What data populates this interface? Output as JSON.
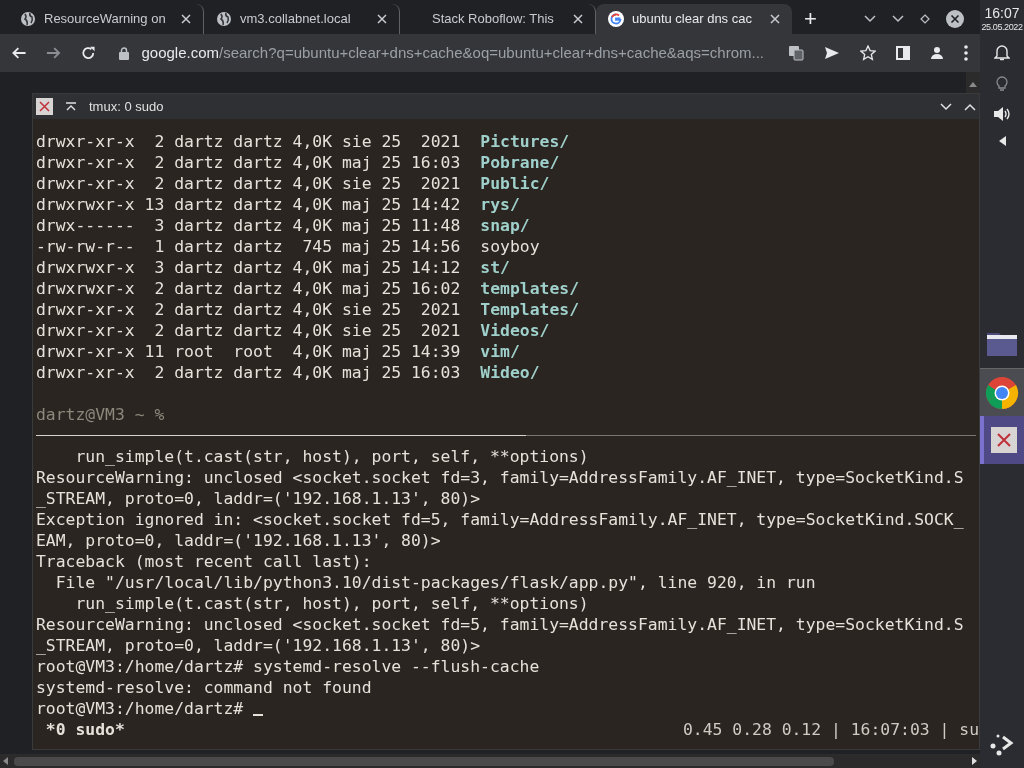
{
  "browser": {
    "tabs": [
      {
        "title": "ResourceWarning on",
        "kind": "globe",
        "selected": false
      },
      {
        "title": "vm3.collabnet.local",
        "kind": "globe",
        "selected": false
      },
      {
        "title": "Stack Roboflow: This",
        "kind": "plain",
        "selected": false
      },
      {
        "title": "ubuntu clear dns cac",
        "kind": "google",
        "selected": true
      }
    ],
    "new_tab": "+",
    "address": {
      "host": "google.com",
      "path": "/search?q=ubuntu+clear+dns+cache&oq=ubuntu+clear+dns+cache&aqs=chrom..."
    }
  },
  "terminal": {
    "title": "tmux: 0 sudo",
    "listing": [
      {
        "info": "drwxr-xr-x  2 dartz dartz 4,0K sie 25  2021",
        "name": "Pictures/",
        "kind": "directory"
      },
      {
        "info": "drwxr-xr-x  2 dartz dartz 4,0K maj 25 16:03",
        "name": "Pobrane/",
        "kind": "directory"
      },
      {
        "info": "drwxr-xr-x  2 dartz dartz 4,0K sie 25  2021",
        "name": "Public/",
        "kind": "directory"
      },
      {
        "info": "drwxrwxr-x 13 dartz dartz 4,0K maj 25 14:42",
        "name": "rys/",
        "kind": "directory"
      },
      {
        "info": "drwx------  3 dartz dartz 4,0K maj 25 11:48",
        "name": "snap/",
        "kind": "directory"
      },
      {
        "info": "-rw-rw-r--  1 dartz dartz  745 maj 25 14:56",
        "name": "soyboy",
        "kind": "file"
      },
      {
        "info": "drwxrwxr-x  3 dartz dartz 4,0K maj 25 14:12",
        "name": "st/",
        "kind": "directory"
      },
      {
        "info": "drwxrwxr-x  2 dartz dartz 4,0K maj 25 16:02",
        "name": "templates/",
        "kind": "directory"
      },
      {
        "info": "drwxr-xr-x  2 dartz dartz 4,0K sie 25  2021",
        "name": "Templates/",
        "kind": "directory"
      },
      {
        "info": "drwxr-xr-x  2 dartz dartz 4,0K sie 25  2021",
        "name": "Videos/",
        "kind": "directory"
      },
      {
        "info": "drwxr-xr-x 11 root  root  4,0K maj 25 14:39",
        "name": "vim/",
        "kind": "directory"
      },
      {
        "info": "drwxr-xr-x  2 dartz dartz 4,0K maj 25 16:03",
        "name": "Wideo/",
        "kind": "directory"
      }
    ],
    "prompt": "dartz@VM3 ~ %",
    "output": [
      "    run_simple(t.cast(str, host), port, self, **options)",
      "ResourceWarning: unclosed <socket.socket fd=3, family=AddressFamily.AF_INET, type=SocketKind.S",
      "_STREAM, proto=0, laddr=('192.168.1.13', 80)>",
      "Exception ignored in: <socket.socket fd=5, family=AddressFamily.AF_INET, type=SocketKind.SOCK_",
      "EAM, proto=0, laddr=('192.168.1.13', 80)>",
      "Traceback (most recent call last):",
      "  File \"/usr/local/lib/python3.10/dist-packages/flask/app.py\", line 920, in run",
      "    run_simple(t.cast(str, host), port, self, **options)",
      "ResourceWarning: unclosed <socket.socket fd=5, family=AddressFamily.AF_INET, type=SocketKind.S",
      "_STREAM, proto=0, laddr=('192.168.1.13', 80)>",
      "root@VM3:/home/dartz# systemd-resolve --flush-cache",
      "systemd-resolve: command not found",
      "root@VM3:/home/dartz# "
    ],
    "status_left": " *0 sudo*",
    "status_right": "0.45 0.28 0.12 | 16:07:03 | su"
  },
  "panel": {
    "time": "16:07",
    "date": "25.05.2022",
    "taskbar": [
      {
        "kind": "folder",
        "open": false,
        "selected": false
      },
      {
        "kind": "browser",
        "open": true,
        "selected": false
      },
      {
        "kind": "terminal",
        "open": true,
        "selected": true
      }
    ]
  }
}
